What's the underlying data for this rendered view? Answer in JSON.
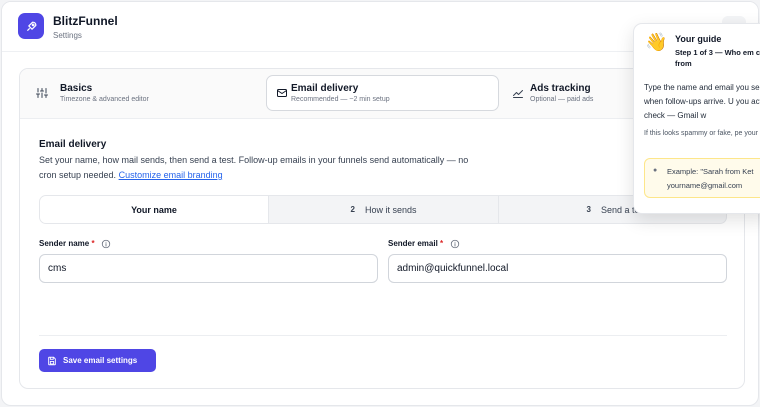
{
  "app": {
    "title": "BlitzFunnel",
    "subtitle": "Settings"
  },
  "tabs": [
    {
      "label": "Basics",
      "desc": "Timezone & advanced editor",
      "icon": "sliders-icon"
    },
    {
      "label": "Email delivery",
      "desc": "Recommended — ~2 min setup",
      "icon": "envelope-icon"
    },
    {
      "label": "Ads tracking",
      "desc": "Optional — paid ads",
      "icon": "chart-icon"
    }
  ],
  "section": {
    "title": "Email delivery",
    "desc": "Set your name, how mail sends, then send a test. Follow-up emails in your funnels send automatically — no cron setup needed.",
    "link": "Customize email branding"
  },
  "steps": [
    {
      "num": "",
      "label": "Your name"
    },
    {
      "num": "2",
      "label": "How it sends"
    },
    {
      "num": "3",
      "label": "Send a te"
    }
  ],
  "form": {
    "sender_name_label": "Sender name",
    "sender_name_value": "cms",
    "sender_email_label": "Sender email",
    "sender_email_value": "admin@quickfunnel.local",
    "required_mark": "*"
  },
  "save_label": "Save email settings",
  "guide": {
    "wave": "👋",
    "title": "Your guide",
    "step": "Step 1 of 3 — Who em come from",
    "body": "Type the name and email you see when follow-ups arrive. U you actually check — Gmail w",
    "note": "If this looks spammy or fake, pe your emails.",
    "example_line1": "Example: \"Sarah from Ket",
    "example_line2": "yourname@gmail.com"
  },
  "colors": {
    "accent": "#4f46e5",
    "link": "#2563eb",
    "required": "#dc2626"
  }
}
